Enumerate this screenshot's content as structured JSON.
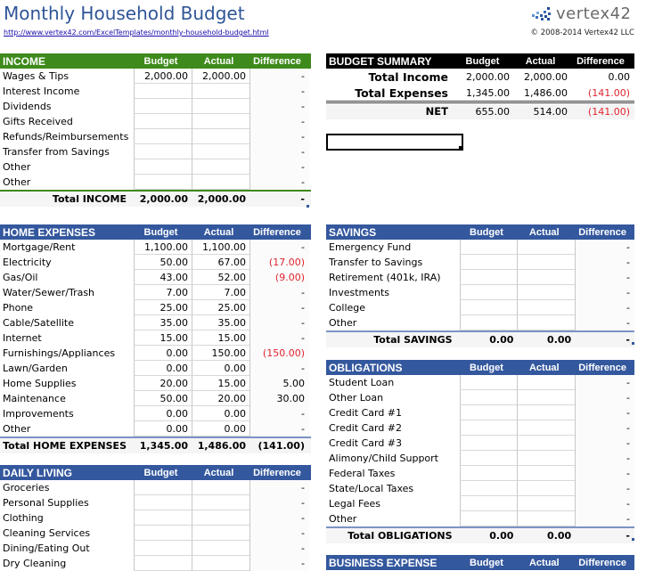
{
  "header": {
    "title": "Monthly Household Budget",
    "link": "http://www.vertex42.com/ExcelTemplates/monthly-household-budget.html",
    "logo_text": "vertex42",
    "logo_icon": "vertex42-logo-icon",
    "copyright": "© 2008-2014 Vertex42 LLC"
  },
  "columns": {
    "budget": "Budget",
    "actual": "Actual",
    "difference": "Difference"
  },
  "colors": {
    "income_header": "#3e8a1c",
    "section_header": "#34589e",
    "summary_header": "#000000",
    "negative": "#e0242e",
    "title": "#2f5597"
  },
  "income": {
    "title": "INCOME",
    "rows": [
      {
        "label": "Wages & Tips",
        "budget": "2,000.00",
        "actual": "2,000.00",
        "diff": "-"
      },
      {
        "label": "Interest Income",
        "budget": "",
        "actual": "",
        "diff": "-"
      },
      {
        "label": "Dividends",
        "budget": "",
        "actual": "",
        "diff": "-"
      },
      {
        "label": "Gifts Received",
        "budget": "",
        "actual": "",
        "diff": "-"
      },
      {
        "label": "Refunds/Reimbursements",
        "budget": "",
        "actual": "",
        "diff": "-"
      },
      {
        "label": "Transfer from Savings",
        "budget": "",
        "actual": "",
        "diff": "-"
      },
      {
        "label": "Other",
        "budget": "",
        "actual": "",
        "diff": "-"
      },
      {
        "label": "Other",
        "budget": "",
        "actual": "",
        "diff": "-"
      }
    ],
    "total": {
      "label": "Total INCOME",
      "budget": "2,000.00",
      "actual": "2,000.00",
      "diff": "-"
    }
  },
  "summary": {
    "title": "BUDGET SUMMARY",
    "rows": [
      {
        "label": "Total Income",
        "budget": "2,000.00",
        "actual": "2,000.00",
        "diff": "0.00"
      },
      {
        "label": "Total Expenses",
        "budget": "1,345.00",
        "actual": "1,486.00",
        "diff": "(141.00)"
      }
    ],
    "net": {
      "label": "NET",
      "budget": "655.00",
      "actual": "514.00",
      "diff": "(141.00)"
    }
  },
  "home_expenses": {
    "title": "HOME EXPENSES",
    "rows": [
      {
        "label": "Mortgage/Rent",
        "budget": "1,100.00",
        "actual": "1,100.00",
        "diff": "-"
      },
      {
        "label": "Electricity",
        "budget": "50.00",
        "actual": "67.00",
        "diff": "(17.00)"
      },
      {
        "label": "Gas/Oil",
        "budget": "43.00",
        "actual": "52.00",
        "diff": "(9.00)"
      },
      {
        "label": "Water/Sewer/Trash",
        "budget": "7.00",
        "actual": "7.00",
        "diff": "-"
      },
      {
        "label": "Phone",
        "budget": "25.00",
        "actual": "25.00",
        "diff": "-"
      },
      {
        "label": "Cable/Satellite",
        "budget": "35.00",
        "actual": "35.00",
        "diff": "-"
      },
      {
        "label": "Internet",
        "budget": "15.00",
        "actual": "15.00",
        "diff": "-"
      },
      {
        "label": "Furnishings/Appliances",
        "budget": "0.00",
        "actual": "150.00",
        "diff": "(150.00)"
      },
      {
        "label": "Lawn/Garden",
        "budget": "0.00",
        "actual": "0.00",
        "diff": "-"
      },
      {
        "label": "Home Supplies",
        "budget": "20.00",
        "actual": "15.00",
        "diff": "5.00"
      },
      {
        "label": "Maintenance",
        "budget": "50.00",
        "actual": "20.00",
        "diff": "30.00"
      },
      {
        "label": "Improvements",
        "budget": "0.00",
        "actual": "0.00",
        "diff": "-"
      },
      {
        "label": "Other",
        "budget": "0.00",
        "actual": "0.00",
        "diff": "-"
      }
    ],
    "total": {
      "label": "Total HOME EXPENSES",
      "budget": "1,345.00",
      "actual": "1,486.00",
      "diff": "(141.00)"
    }
  },
  "daily_living": {
    "title": "DAILY LIVING",
    "rows": [
      {
        "label": "Groceries",
        "budget": "",
        "actual": "",
        "diff": "-"
      },
      {
        "label": "Personal Supplies",
        "budget": "",
        "actual": "",
        "diff": "-"
      },
      {
        "label": "Clothing",
        "budget": "",
        "actual": "",
        "diff": "-"
      },
      {
        "label": "Cleaning Services",
        "budget": "",
        "actual": "",
        "diff": "-"
      },
      {
        "label": "Dining/Eating Out",
        "budget": "",
        "actual": "",
        "diff": "-"
      },
      {
        "label": "Dry Cleaning",
        "budget": "",
        "actual": "",
        "diff": "-"
      }
    ]
  },
  "savings": {
    "title": "SAVINGS",
    "rows": [
      {
        "label": "Emergency Fund",
        "budget": "",
        "actual": "",
        "diff": "-"
      },
      {
        "label": "Transfer to Savings",
        "budget": "",
        "actual": "",
        "diff": "-"
      },
      {
        "label": "Retirement (401k, IRA)",
        "budget": "",
        "actual": "",
        "diff": "-"
      },
      {
        "label": "Investments",
        "budget": "",
        "actual": "",
        "diff": "-"
      },
      {
        "label": "College",
        "budget": "",
        "actual": "",
        "diff": "-"
      },
      {
        "label": "Other",
        "budget": "",
        "actual": "",
        "diff": "-"
      }
    ],
    "total": {
      "label": "Total SAVINGS",
      "budget": "0.00",
      "actual": "0.00",
      "diff": "-"
    }
  },
  "obligations": {
    "title": "OBLIGATIONS",
    "rows": [
      {
        "label": "Student Loan",
        "budget": "",
        "actual": "",
        "diff": "-"
      },
      {
        "label": "Other Loan",
        "budget": "",
        "actual": "",
        "diff": "-"
      },
      {
        "label": "Credit Card #1",
        "budget": "",
        "actual": "",
        "diff": "-"
      },
      {
        "label": "Credit Card #2",
        "budget": "",
        "actual": "",
        "diff": "-"
      },
      {
        "label": "Credit Card #3",
        "budget": "",
        "actual": "",
        "diff": "-"
      },
      {
        "label": "Alimony/Child Support",
        "budget": "",
        "actual": "",
        "diff": "-"
      },
      {
        "label": "Federal Taxes",
        "budget": "",
        "actual": "",
        "diff": "-"
      },
      {
        "label": "State/Local Taxes",
        "budget": "",
        "actual": "",
        "diff": "-"
      },
      {
        "label": "Legal Fees",
        "budget": "",
        "actual": "",
        "diff": "-"
      },
      {
        "label": "Other",
        "budget": "",
        "actual": "",
        "diff": "-"
      }
    ],
    "total": {
      "label": "Total OBLIGATIONS",
      "budget": "0.00",
      "actual": "0.00",
      "diff": "-"
    }
  },
  "business_expense": {
    "title": "BUSINESS EXPENSE"
  }
}
